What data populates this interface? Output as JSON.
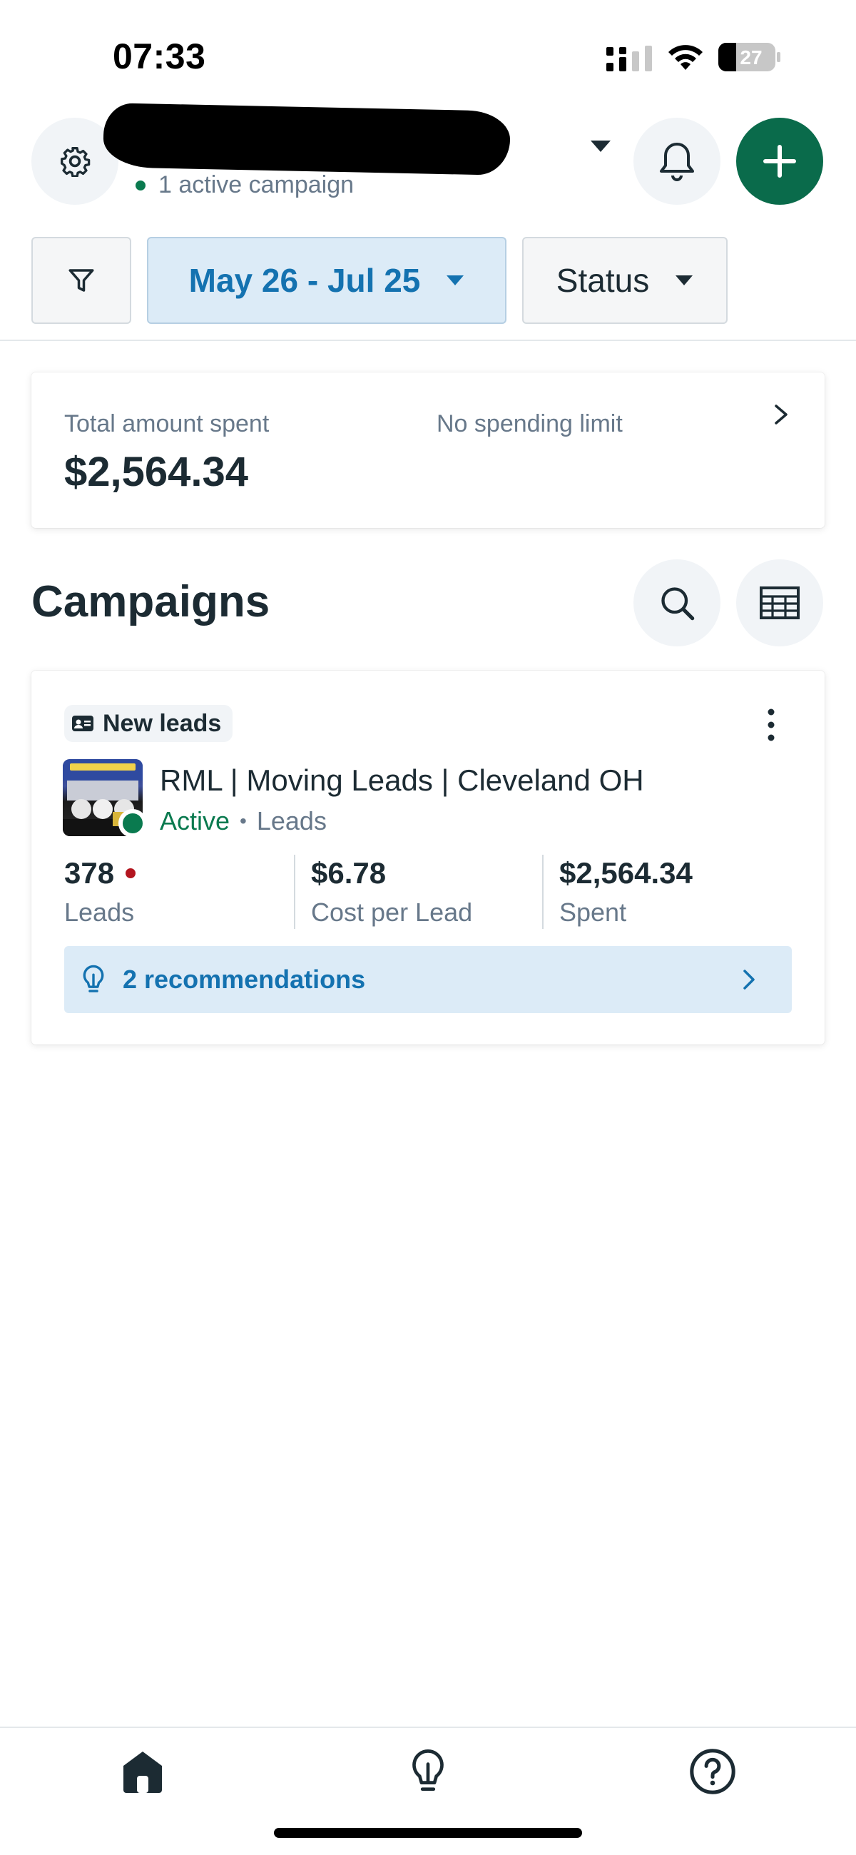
{
  "status_bar": {
    "time": "07:33",
    "battery": "27"
  },
  "header": {
    "account_name_redacted": true,
    "active_campaigns": "1 active campaign"
  },
  "filters": {
    "date_range": "May 26 - Jul 25",
    "status": "Status"
  },
  "spending": {
    "label": "Total amount spent",
    "value": "$2,564.34",
    "limit": "No spending limit"
  },
  "campaigns": {
    "title": "Campaigns",
    "items": [
      {
        "tag": "New leads",
        "name": "RML | Moving Leads | Cleveland OH",
        "status": "Active",
        "separator": "•",
        "objective": "Leads",
        "metrics": [
          {
            "value": "378",
            "label": "Leads",
            "new_indicator": true
          },
          {
            "value": "$6.78",
            "label": "Cost per Lead"
          },
          {
            "value": "$2,564.34",
            "label": "Spent"
          }
        ],
        "recommendations": "2 recommendations"
      }
    ]
  },
  "bottom_nav": [
    {
      "icon": "home-icon",
      "selected": true
    },
    {
      "icon": "lightbulb-icon",
      "selected": false
    },
    {
      "icon": "help-icon",
      "selected": false
    }
  ],
  "colors": {
    "accent_green": "#0a6b4b",
    "active_green": "#0a7a4f",
    "link_blue": "#1472b0",
    "highlight_blue": "#dcebf7",
    "alert_red": "#b3151f"
  }
}
